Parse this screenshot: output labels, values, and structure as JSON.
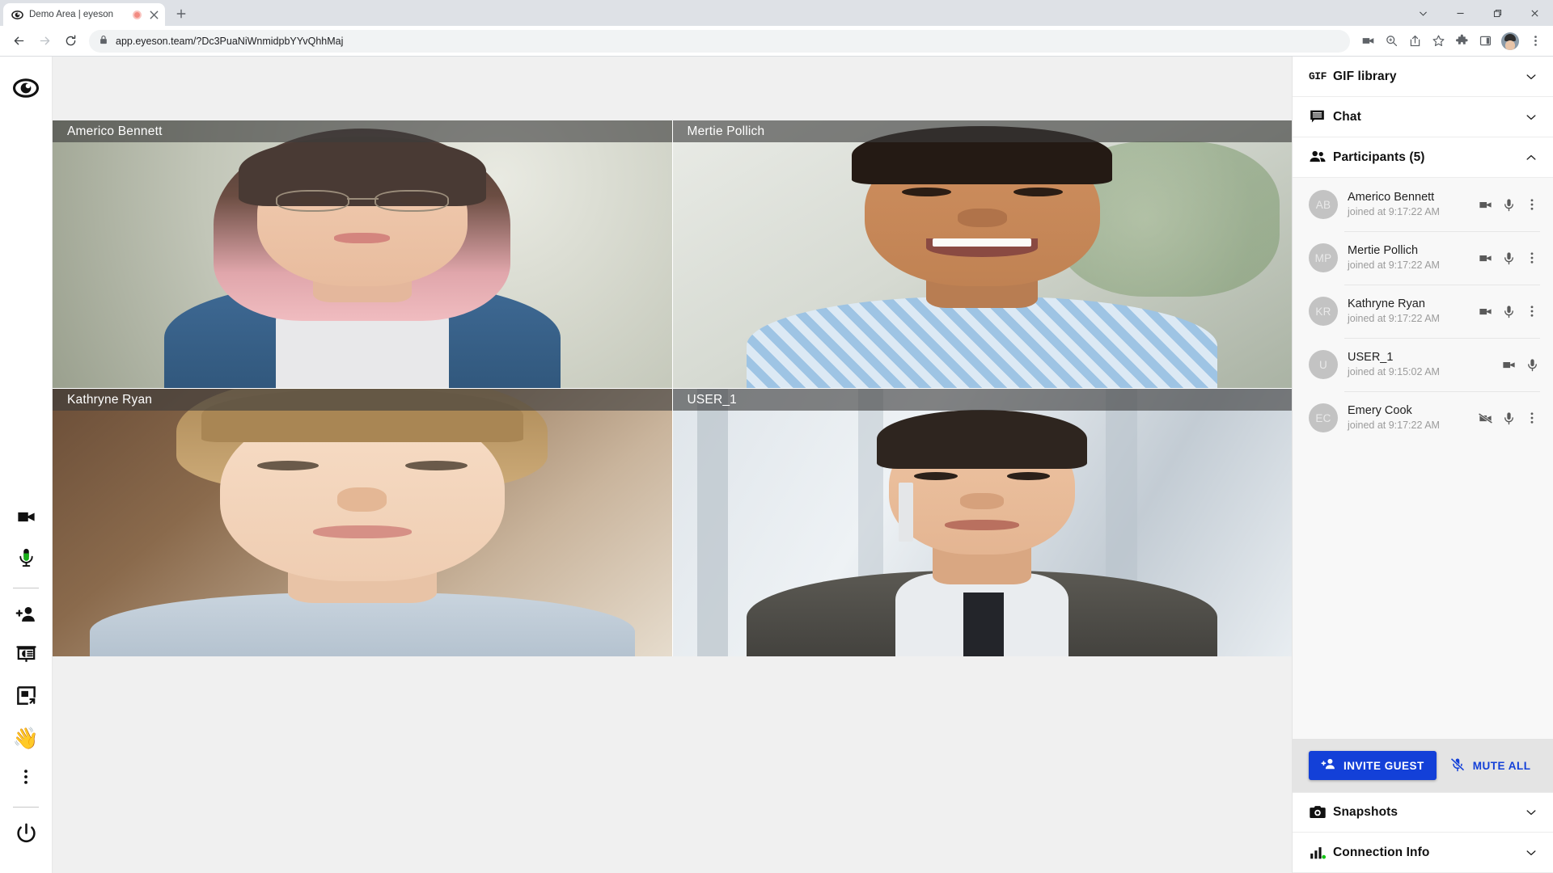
{
  "browser": {
    "tab": {
      "title": "Demo Area | eyeson",
      "favicon_icon": "eyeson-eye-icon",
      "recording_icon": "recording-dot-icon",
      "close_icon": "close-icon"
    },
    "new_tab_icon": "plus-icon",
    "window_controls": [
      {
        "name": "tab-search",
        "icon": "chevron-down-icon",
        "glyph": "⌄"
      },
      {
        "name": "minimize",
        "icon": "minimize-icon",
        "glyph": "—"
      },
      {
        "name": "maximize",
        "icon": "restore-icon",
        "glyph": "❐"
      },
      {
        "name": "close",
        "icon": "close-icon",
        "glyph": "✕"
      }
    ],
    "nav": {
      "back_icon": "arrow-left-icon",
      "forward_icon": "arrow-right-icon",
      "reload_icon": "reload-icon"
    },
    "omnibox": {
      "lock_icon": "lock-icon",
      "url": "app.eyeson.team/?Dc3PuaNiWnmidpbYYvQhhMaj"
    },
    "toolbar_icons": [
      {
        "name": "media-cast-icon",
        "label": "video"
      },
      {
        "name": "zoom-icon",
        "label": "zoom"
      },
      {
        "name": "share-icon",
        "label": "share"
      },
      {
        "name": "bookmark-star-icon",
        "label": "bookmark"
      },
      {
        "name": "extensions-puzzle-icon",
        "label": "extensions"
      },
      {
        "name": "side-panel-icon",
        "label": "side panel"
      }
    ],
    "profile_avatar": "profile-avatar",
    "menu_icon": "three-dot-menu-icon"
  },
  "rail": {
    "logo_icon": "eyeson-logo-icon",
    "items": [
      {
        "name": "camera-toggle",
        "icon": "video-camera-icon"
      },
      {
        "name": "microphone-toggle",
        "icon": "microphone-icon"
      },
      {
        "name": "invite-participant",
        "icon": "person-add-icon"
      },
      {
        "name": "presentation-share",
        "icon": "presentation-icon"
      },
      {
        "name": "picture-in-picture",
        "icon": "pip-icon"
      },
      {
        "name": "raise-hand",
        "icon": "waving-hand-icon",
        "glyph": "👋"
      },
      {
        "name": "more-options",
        "icon": "three-dot-menu-icon"
      },
      {
        "name": "leave-call",
        "icon": "power-icon"
      }
    ]
  },
  "stage": {
    "cells": [
      {
        "label": "Americo Bennett"
      },
      {
        "label": "Mertie Pollich"
      },
      {
        "label": "Kathryne Ryan"
      },
      {
        "label": "USER_1"
      }
    ]
  },
  "sidebar": {
    "sections": [
      {
        "name": "gif-library",
        "title": "GIF library",
        "icon": "gif-icon",
        "expanded": false,
        "chevron": "chevron-down-icon"
      },
      {
        "name": "chat",
        "title": "Chat",
        "icon": "chat-bubble-icon",
        "expanded": false,
        "chevron": "chevron-down-icon"
      },
      {
        "name": "participants",
        "title": "Participants (5)",
        "icon": "people-icon",
        "expanded": true,
        "chevron": "chevron-up-icon"
      }
    ],
    "participants": [
      {
        "initials": "AB",
        "name": "Americo Bennett",
        "joined": "joined at 9:17:22 AM",
        "camera_icon": "video-camera-icon",
        "camera_on": true,
        "mic_icon": "microphone-icon",
        "mic_on": true,
        "has_menu": true
      },
      {
        "initials": "MP",
        "name": "Mertie Pollich",
        "joined": "joined at 9:17:22 AM",
        "camera_icon": "video-camera-icon",
        "camera_on": true,
        "mic_icon": "microphone-icon",
        "mic_on": true,
        "has_menu": true
      },
      {
        "initials": "KR",
        "name": "Kathryne Ryan",
        "joined": "joined at 9:17:22 AM",
        "camera_icon": "video-camera-icon",
        "camera_on": true,
        "mic_icon": "microphone-icon",
        "mic_on": true,
        "has_menu": true
      },
      {
        "initials": "U",
        "name": "USER_1",
        "joined": "joined at 9:15:02 AM",
        "camera_icon": "video-camera-icon",
        "camera_on": true,
        "mic_icon": "microphone-icon",
        "mic_on": true,
        "has_menu": false
      },
      {
        "initials": "EC",
        "name": "Emery Cook",
        "joined": "joined at 9:17:22 AM",
        "camera_icon": "video-camera-off-icon",
        "camera_on": false,
        "mic_icon": "microphone-icon",
        "mic_on": true,
        "has_menu": true
      }
    ],
    "footer": {
      "invite_label": "INVITE GUEST",
      "invite_icon": "person-add-icon",
      "mute_all_label": "MUTE ALL",
      "mute_all_icon": "microphone-off-icon"
    },
    "bottom_sections": [
      {
        "name": "snapshots",
        "title": "Snapshots",
        "icon": "camera-icon",
        "chevron": "chevron-down-icon"
      },
      {
        "name": "connection-info",
        "title": "Connection Info",
        "icon": "signal-bars-icon",
        "chevron": "chevron-down-icon"
      }
    ]
  },
  "colors": {
    "accent_blue": "#1340d8",
    "status_green": "#18b018",
    "recording_red": "#f28b82",
    "label_overlay": "rgba(60,60,60,0.62)"
  }
}
